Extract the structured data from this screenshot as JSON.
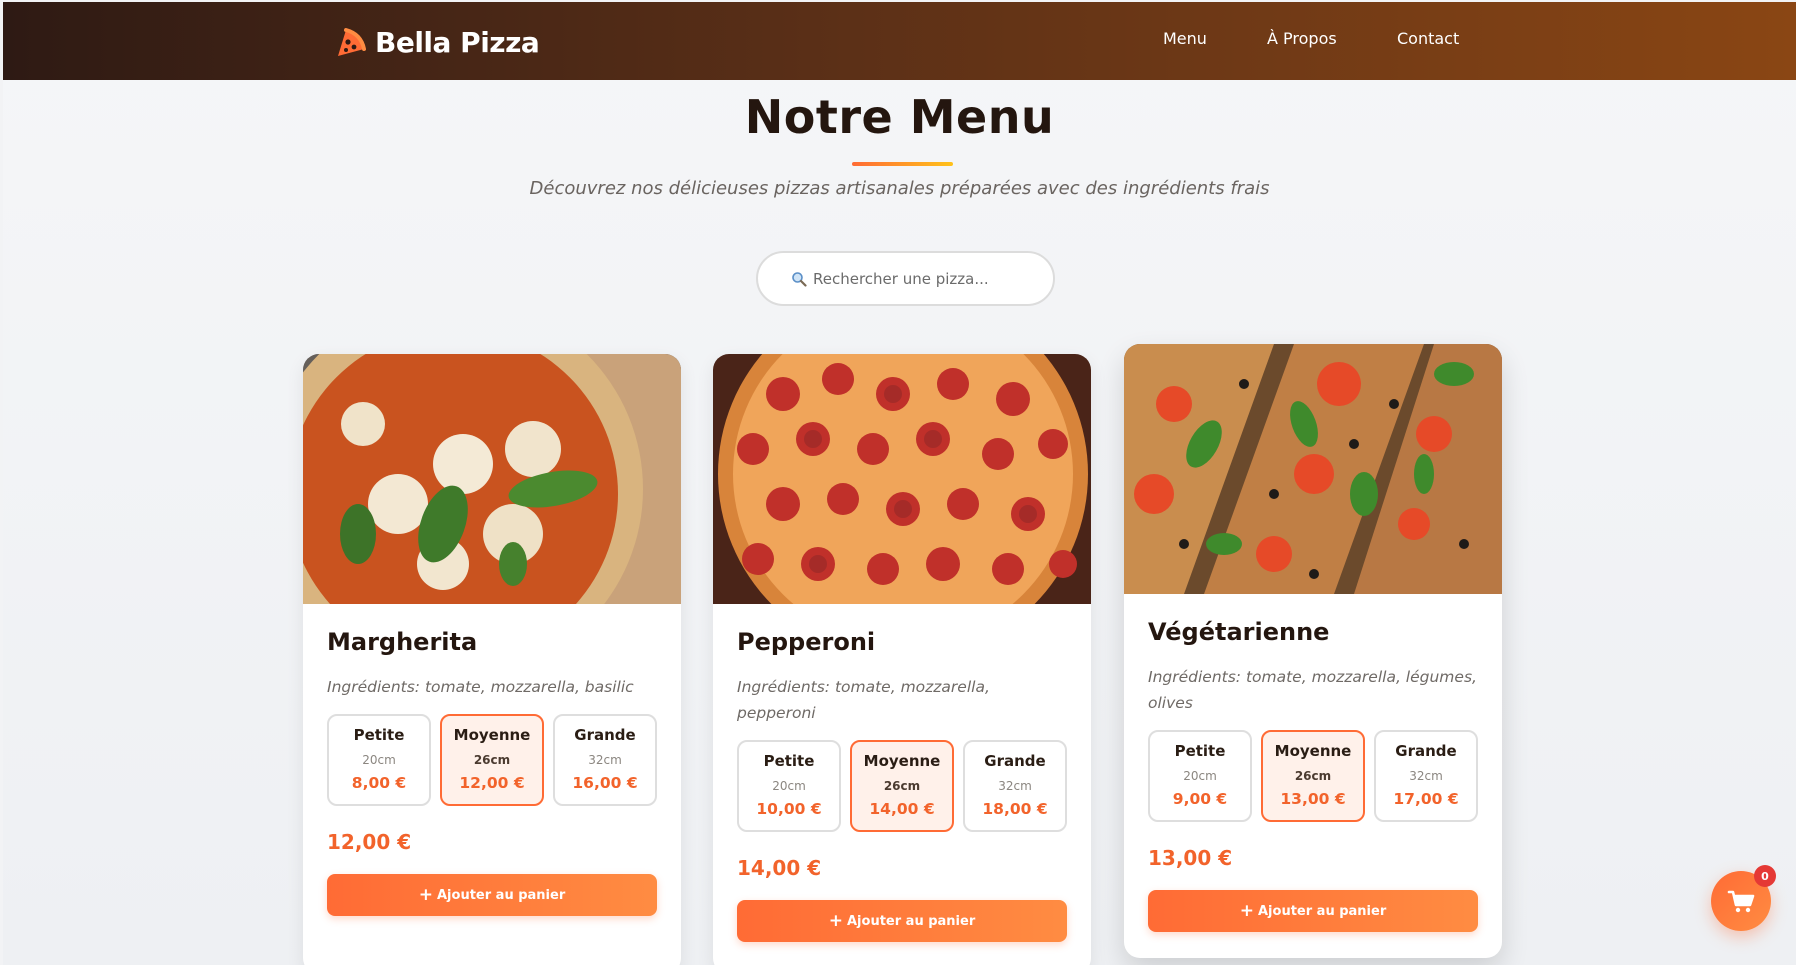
{
  "header": {
    "brand": "Bella Pizza",
    "brand_icon": "pizza-slice-icon",
    "nav": [
      "Menu",
      "À Propos",
      "Contact"
    ]
  },
  "hero": {
    "title": "Notre Menu",
    "subtitle": "Découvrez nos délicieuses pizzas artisanales préparées avec des ingrédients frais"
  },
  "search": {
    "icon": "search-icon",
    "placeholder": "Rechercher une pizza..."
  },
  "pizzas": [
    {
      "name": "Margherita",
      "ingredients": "Ingrédients: tomate, mozzarella, basilic",
      "sizes": [
        {
          "name": "Petite",
          "dim": "20cm",
          "price": "8,00 €",
          "selected": false
        },
        {
          "name": "Moyenne",
          "dim": "26cm",
          "price": "12,00 €",
          "selected": true
        },
        {
          "name": "Grande",
          "dim": "32cm",
          "price": "16,00 €",
          "selected": false
        }
      ],
      "price": "12,00 €",
      "button": "Ajouter au panier"
    },
    {
      "name": "Pepperoni",
      "ingredients": "Ingrédients: tomate, mozzarella, pepperoni",
      "sizes": [
        {
          "name": "Petite",
          "dim": "20cm",
          "price": "10,00 €",
          "selected": false
        },
        {
          "name": "Moyenne",
          "dim": "26cm",
          "price": "14,00 €",
          "selected": true
        },
        {
          "name": "Grande",
          "dim": "32cm",
          "price": "18,00 €",
          "selected": false
        }
      ],
      "price": "14,00 €",
      "button": "Ajouter au panier"
    },
    {
      "name": "Végétarienne",
      "ingredients": "Ingrédients: tomate, mozzarella, légumes, olives",
      "sizes": [
        {
          "name": "Petite",
          "dim": "20cm",
          "price": "9,00 €",
          "selected": false
        },
        {
          "name": "Moyenne",
          "dim": "26cm",
          "price": "13,00 €",
          "selected": true
        },
        {
          "name": "Grande",
          "dim": "32cm",
          "price": "17,00 €",
          "selected": false
        }
      ],
      "price": "13,00 €",
      "button": "Ajouter au panier"
    }
  ],
  "cart": {
    "icon": "shopping-cart-icon",
    "count": "0"
  },
  "colors": {
    "accent": "#ff6b35",
    "header_start": "#2e1a14",
    "header_end": "#8a4614",
    "badge": "#e53935"
  }
}
